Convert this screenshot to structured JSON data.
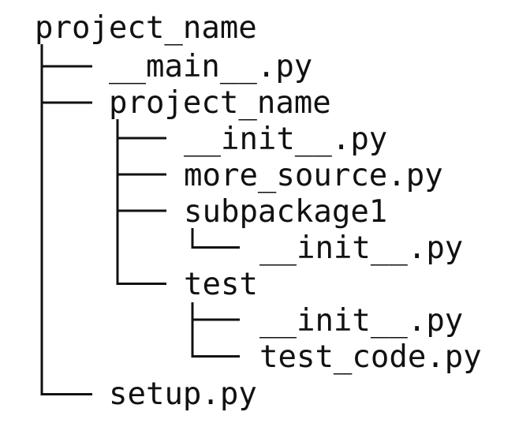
{
  "tree": {
    "color": "#111111",
    "nodes": [
      {
        "id": "root",
        "label": "project_name",
        "depth": 0,
        "type": "folder"
      },
      {
        "id": "main",
        "label": "__main__.py",
        "depth": 1,
        "type": "file"
      },
      {
        "id": "pkg",
        "label": "project_name",
        "depth": 1,
        "type": "folder"
      },
      {
        "id": "pkg-init",
        "label": "__init__.py",
        "depth": 2,
        "type": "file"
      },
      {
        "id": "more-source",
        "label": "more_source.py",
        "depth": 2,
        "type": "file"
      },
      {
        "id": "subpackage1",
        "label": "subpackage1",
        "depth": 2,
        "type": "folder"
      },
      {
        "id": "sub-init",
        "label": "__init__.py",
        "depth": 3,
        "type": "file"
      },
      {
        "id": "test",
        "label": "test",
        "depth": 2,
        "type": "folder"
      },
      {
        "id": "test-init",
        "label": "__init__.py",
        "depth": 3,
        "type": "file"
      },
      {
        "id": "test-code",
        "label": "test_code.py",
        "depth": 3,
        "type": "file"
      },
      {
        "id": "setup",
        "label": "setup.py",
        "depth": 1,
        "type": "file"
      }
    ]
  }
}
